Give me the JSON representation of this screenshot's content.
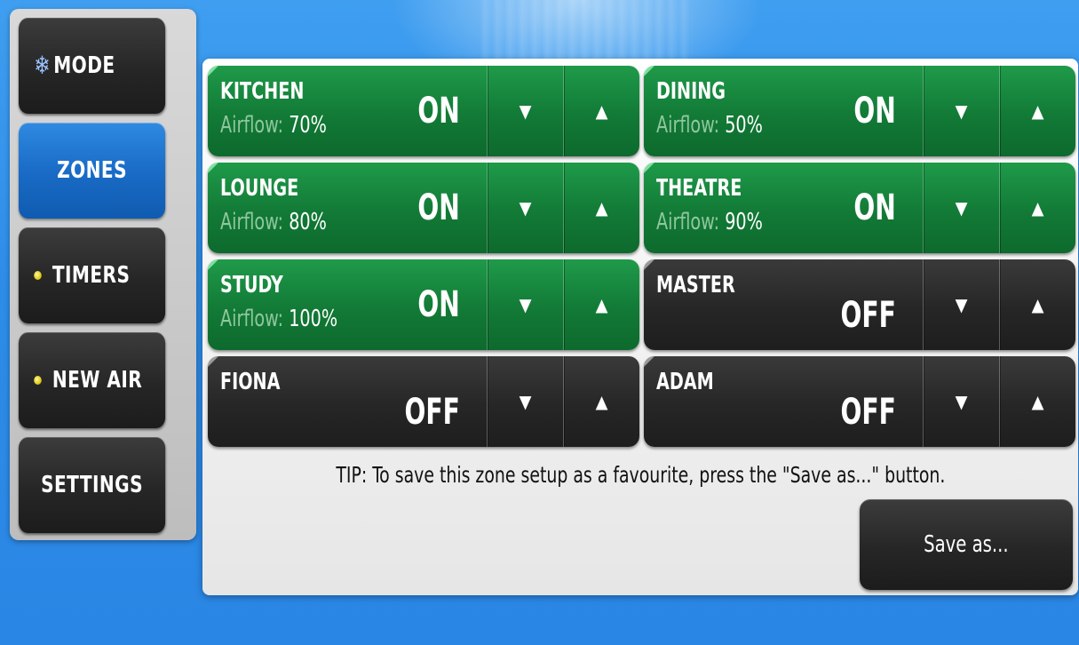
{
  "sidebar": {
    "items": [
      {
        "label": "MODE",
        "icon": "snowflake-icon"
      },
      {
        "label": "ZONES",
        "active": true
      },
      {
        "label": "TIMERS",
        "indicator": true
      },
      {
        "label": "NEW AIR",
        "indicator": true
      },
      {
        "label": "SETTINGS"
      }
    ]
  },
  "zones": [
    {
      "name": "KITCHEN",
      "airflow_label": "Airflow:",
      "airflow_value": "70%",
      "state": "ON"
    },
    {
      "name": "DINING",
      "airflow_label": "Airflow:",
      "airflow_value": "50%",
      "state": "ON"
    },
    {
      "name": "LOUNGE",
      "airflow_label": "Airflow:",
      "airflow_value": "80%",
      "state": "ON"
    },
    {
      "name": "THEATRE",
      "airflow_label": "Airflow:",
      "airflow_value": "90%",
      "state": "ON"
    },
    {
      "name": "STUDY",
      "airflow_label": "Airflow:",
      "airflow_value": "100%",
      "state": "ON"
    },
    {
      "name": "MASTER",
      "state": "OFF"
    },
    {
      "name": "FIONA",
      "state": "OFF"
    },
    {
      "name": "ADAM",
      "state": "OFF"
    }
  ],
  "controls": {
    "down": "▼",
    "up": "▲"
  },
  "tip": "TIP: To save this zone setup as a favourite, press the \"Save as...\" button.",
  "save_button": "Save as...",
  "colors": {
    "zone_on": "#127a36",
    "zone_off": "#262626",
    "nav_active": "#1a6cc7",
    "indicator": "#d8c400",
    "background": "#2d8ce8"
  }
}
